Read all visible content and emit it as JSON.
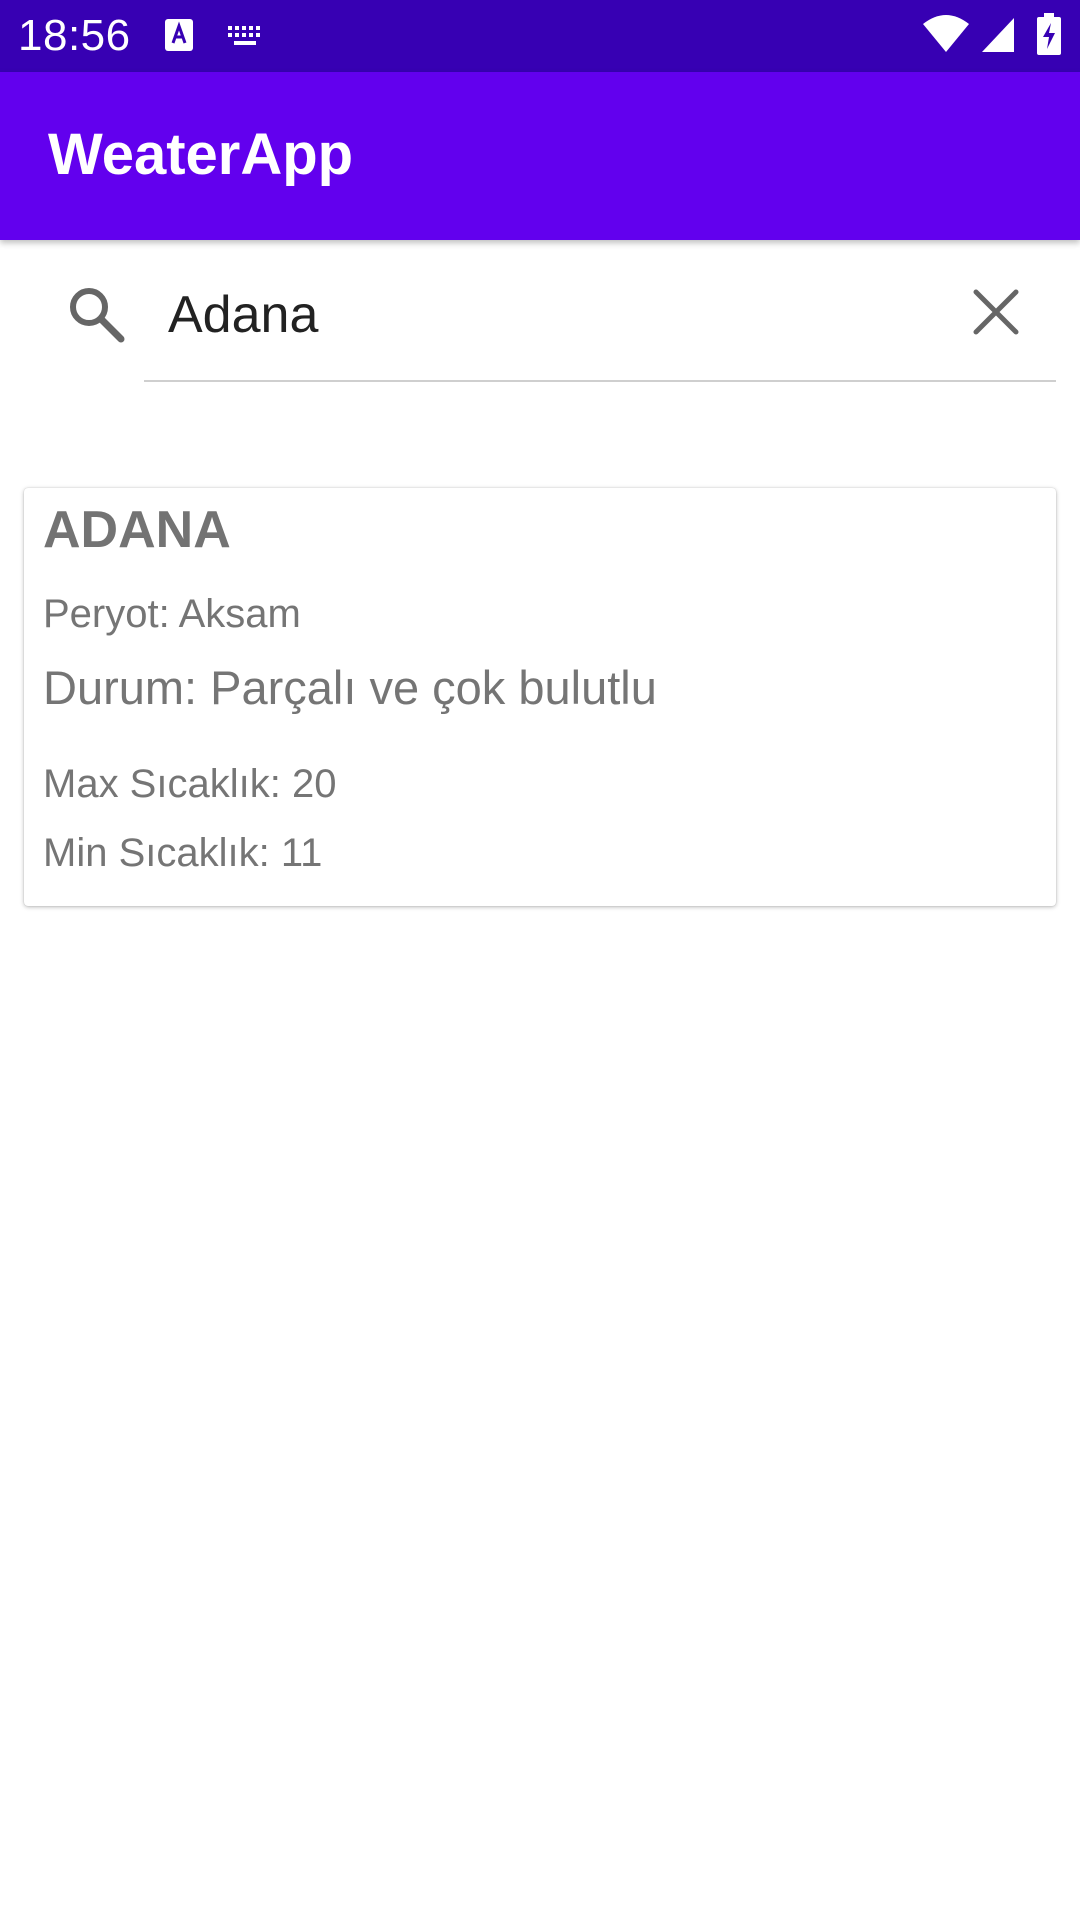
{
  "status_bar": {
    "time": "18:56",
    "icons": [
      "a-notification-icon",
      "keyboard-icon",
      "wifi-icon",
      "signal-icon",
      "battery-charging-icon"
    ]
  },
  "app_bar": {
    "title": "WeaterApp",
    "background": "#6200ee",
    "status_bar_color": "#3700b3"
  },
  "search": {
    "value": "Adana",
    "icons": [
      "search-icon",
      "close-icon"
    ]
  },
  "result_card": {
    "city": "ADANA",
    "period": "Peryot: Aksam",
    "status": "Durum: Parçalı ve çok bulutlu",
    "max_temp": "Max Sıcaklık: 20",
    "min_temp": "Min Sıcaklık: 11"
  }
}
